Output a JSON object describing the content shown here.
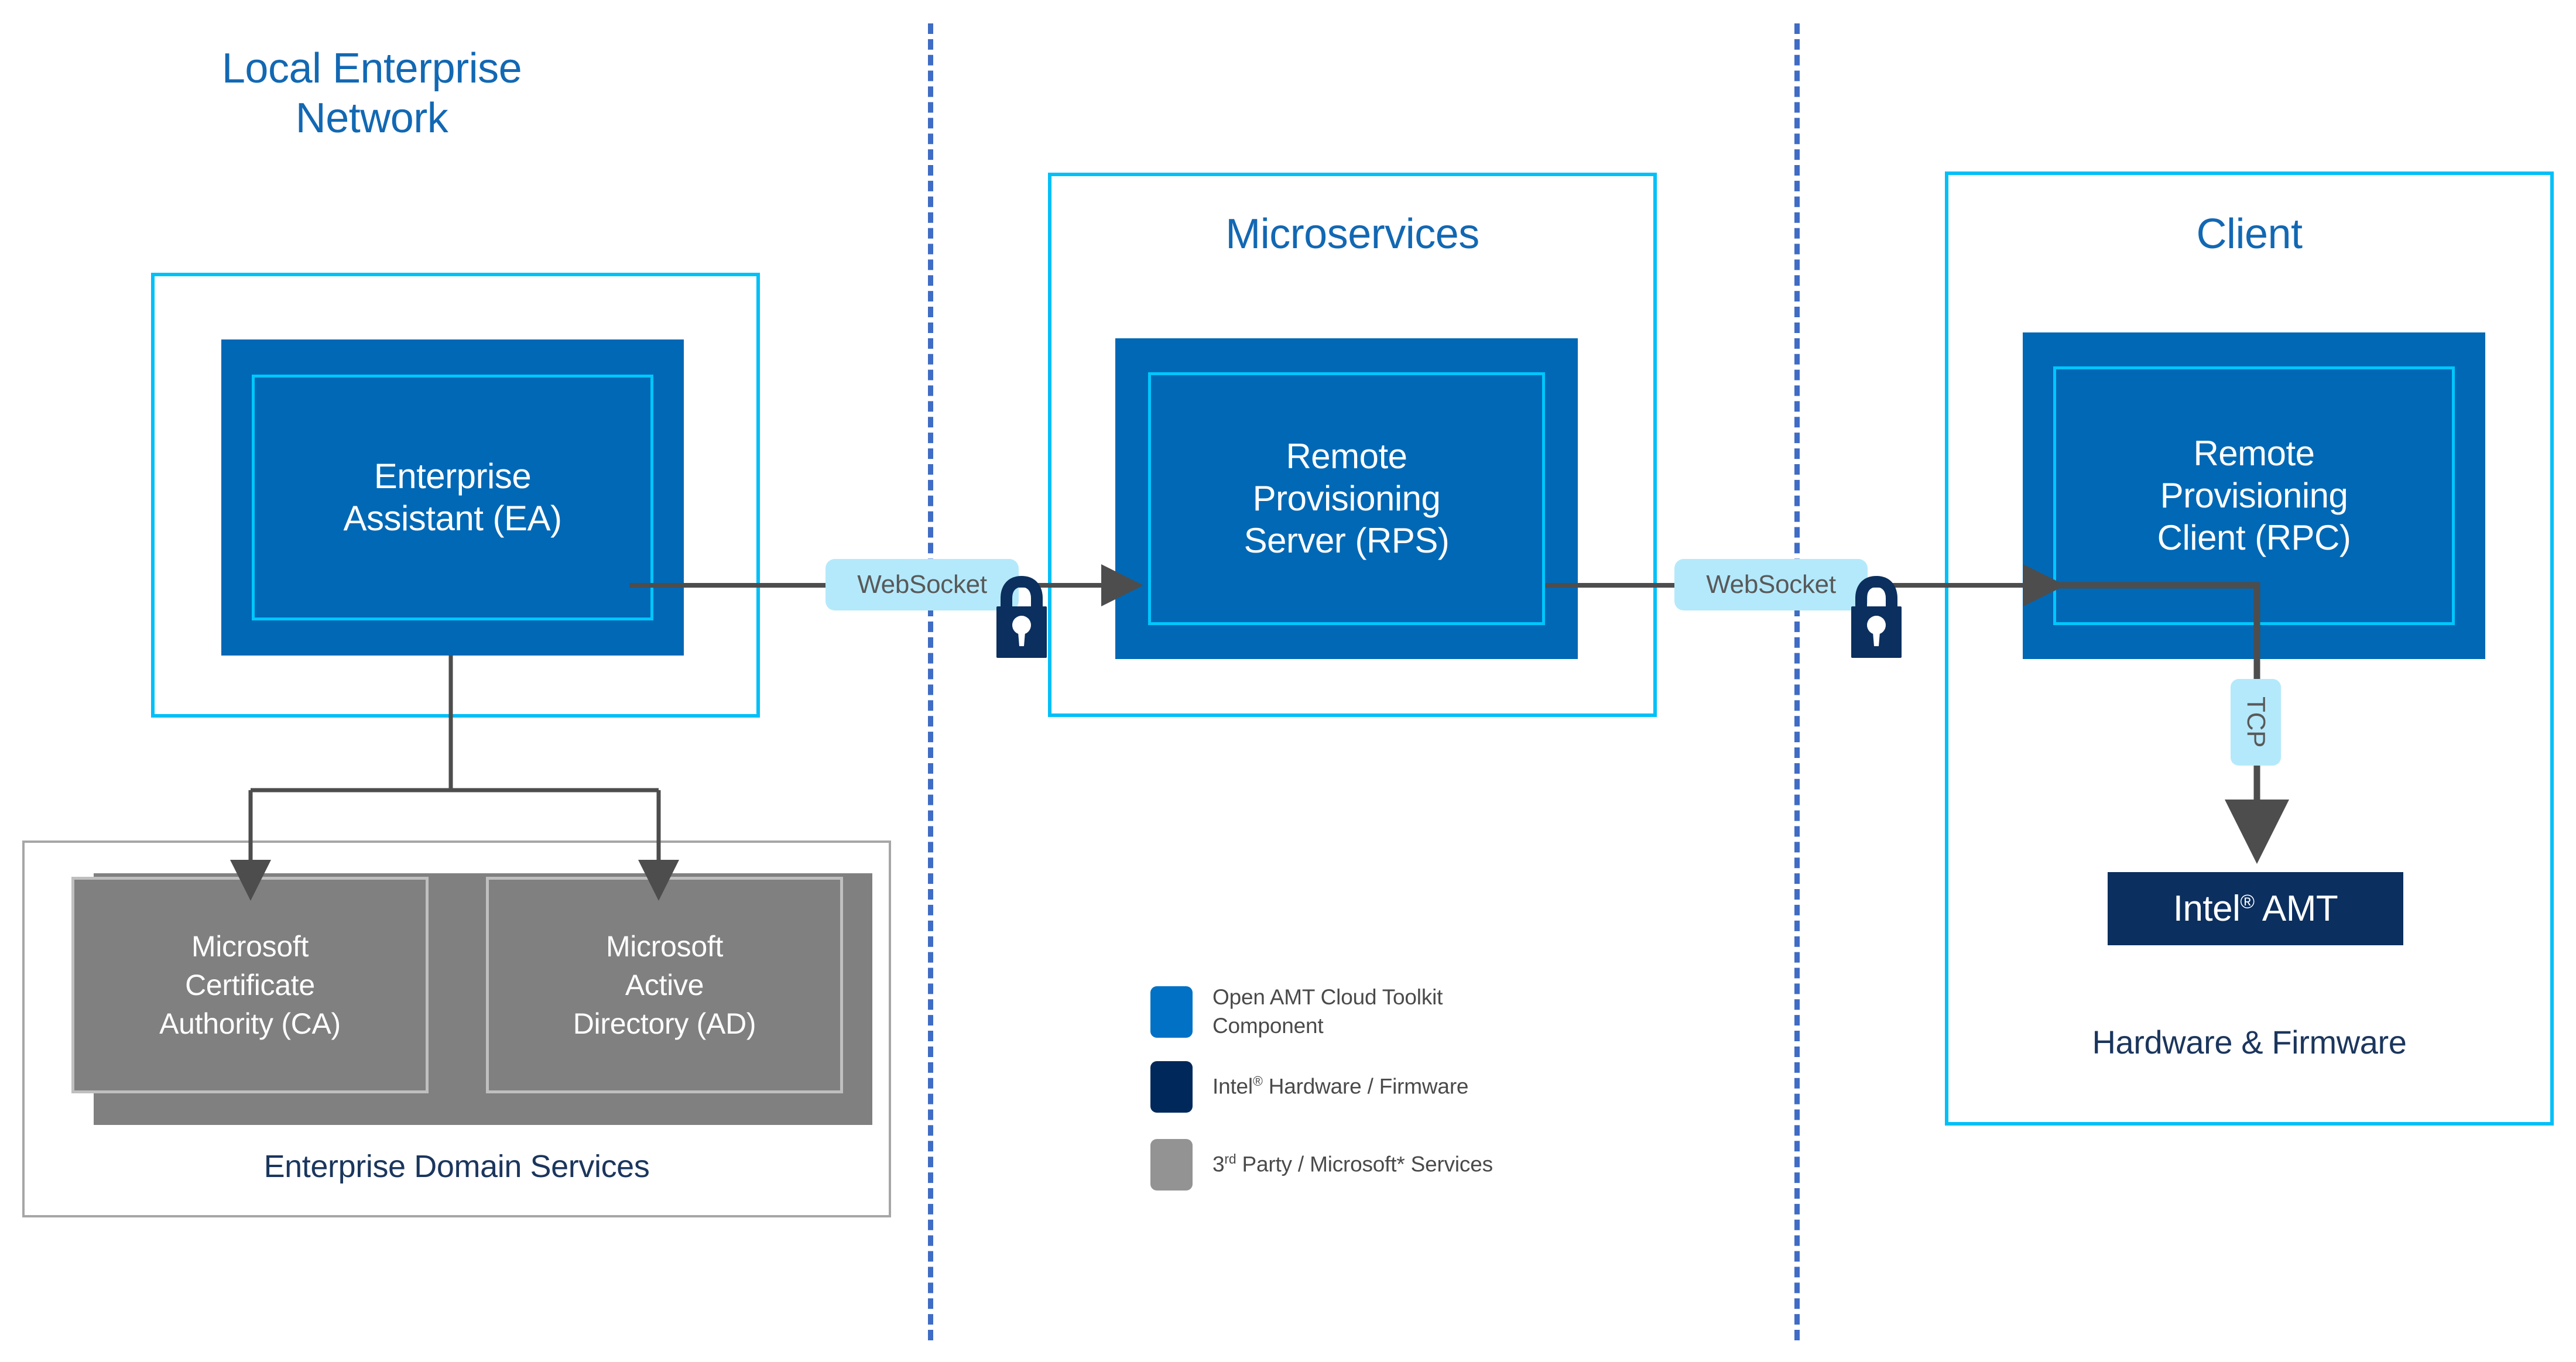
{
  "zones": [
    {
      "id": "local-enterprise-network",
      "title": "Local Enterprise\nNetwork",
      "title_color": "#1268B3"
    },
    {
      "id": "microservices",
      "title": "Microservices",
      "title_color": "#1268B3"
    },
    {
      "id": "client",
      "title": "Client",
      "title_color": "#1268B3"
    }
  ],
  "components": {
    "ea": {
      "label": "Enterprise\nAssistant (EA)"
    },
    "rps": {
      "label": "Remote\nProvisioning\nServer (RPS)"
    },
    "rpc": {
      "label": "Remote\nProvisioning\nClient (RPC)"
    },
    "amt": {
      "label_pre": "Intel",
      "label_sup": "®",
      "label_post": " AMT"
    }
  },
  "enterprise_domain_services": {
    "caption": "Enterprise Domain Services",
    "services": [
      {
        "label": "Microsoft\nCertificate\nAuthority (CA)"
      },
      {
        "label": "Microsoft\nActive\nDirectory (AD)"
      }
    ]
  },
  "client_zone": {
    "hardware_caption": "Hardware & Firmware"
  },
  "connectors": [
    {
      "id": "ea-to-rps",
      "protocol": "WebSocket",
      "secure": true
    },
    {
      "id": "rps-to-rpc",
      "protocol": "WebSocket",
      "secure": true
    },
    {
      "id": "rpc-to-amt",
      "protocol": "TCP",
      "secure": false
    }
  ],
  "legend": {
    "items": [
      {
        "swatch_color": "#0071C5",
        "label": "Open AMT Cloud Toolkit\nComponent"
      },
      {
        "swatch_color": "#00285A",
        "label_pre": "Intel",
        "label_sup": "®",
        "label_post": " Hardware / Firmware"
      },
      {
        "swatch_color": "#939393",
        "label_pre": "3",
        "label_sup": "rd",
        "label_post": " Party / Microsoft* Services"
      }
    ]
  },
  "colors": {
    "component_blue": "#0068B5",
    "accent_cyan": "#00C7FD",
    "zone_border_cyan": "#00C0F8",
    "navy": "#0B2F5E",
    "gray": "#808080",
    "pill_bg": "#B4E9FB",
    "divider_blue": "#3f6cc4",
    "connector_gray": "#4D4D4D"
  }
}
